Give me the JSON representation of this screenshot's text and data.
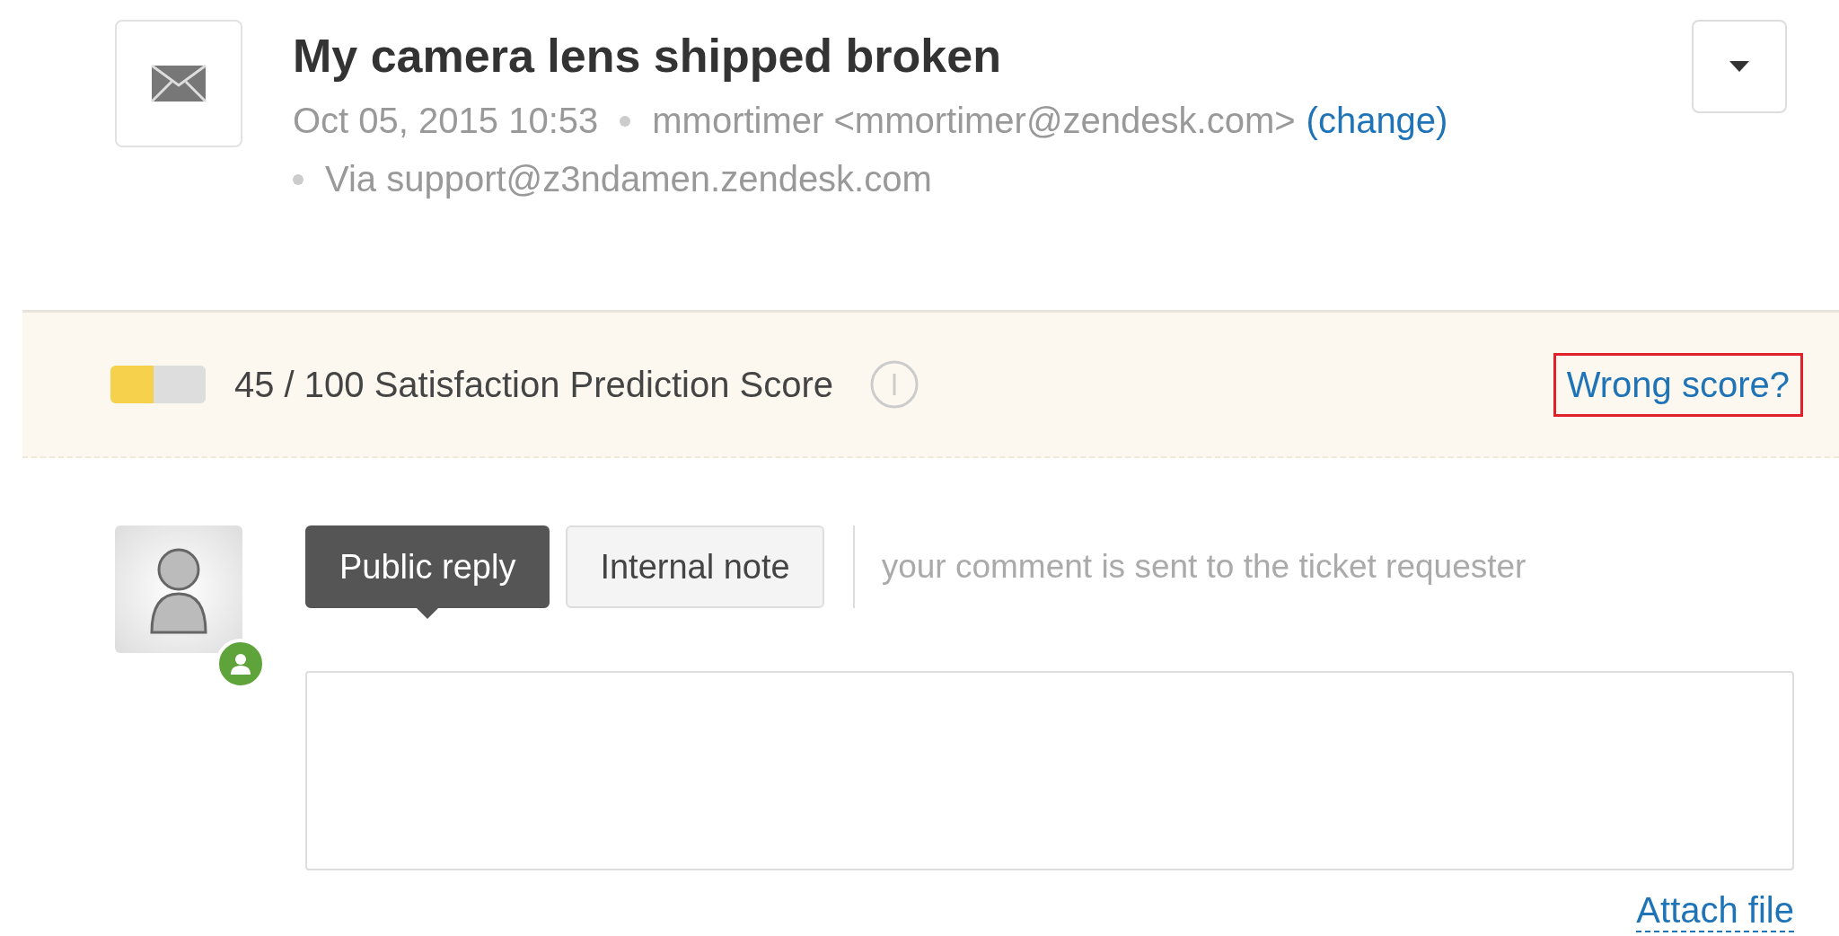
{
  "ticket": {
    "title": "My camera lens shipped broken",
    "date": "Oct 05, 2015 10:53",
    "requester": "mmortimer <mmortimer@zendesk.com>",
    "change_link": "(change)",
    "via": "Via support@z3ndamen.zendesk.com"
  },
  "satisfaction": {
    "level": 0.45,
    "score": "45 / 100 Satisfaction Prediction Score",
    "feedback_link": "Wrong score?",
    "highlighted": true
  },
  "reply": {
    "tabs": [
      {
        "label": "Public reply",
        "selected": true
      },
      {
        "label": "Internal note",
        "selected": false
      }
    ],
    "hint": "your comment is sent to the ticket requester",
    "attach": "Attach file"
  }
}
